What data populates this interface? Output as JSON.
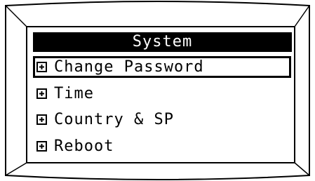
{
  "screen": {
    "title": "System",
    "menu": [
      {
        "label": "Change Password",
        "icon": "expand-plus-icon",
        "selected": true
      },
      {
        "label": "Time",
        "icon": "expand-plus-icon",
        "selected": false
      },
      {
        "label": "Country & SP",
        "icon": "expand-plus-icon",
        "selected": false
      },
      {
        "label": "Reboot",
        "icon": "expand-plus-icon",
        "selected": false
      }
    ]
  },
  "colors": {
    "foreground": "#000000",
    "background": "#ffffff"
  }
}
